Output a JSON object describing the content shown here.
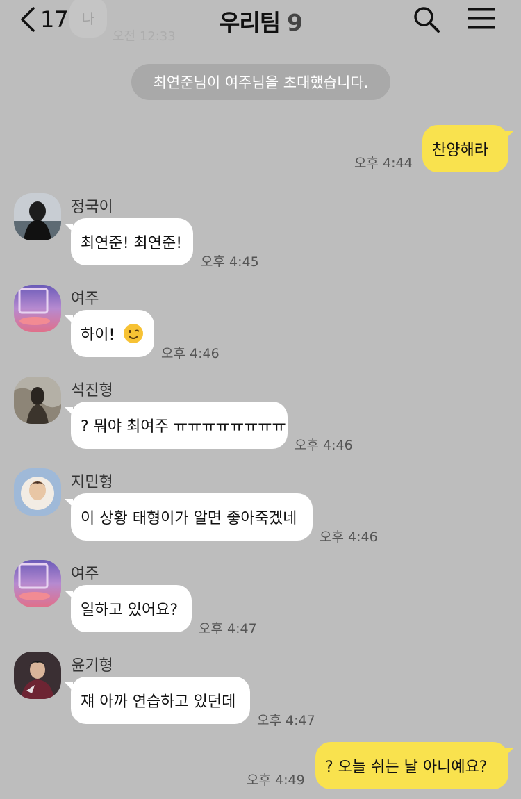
{
  "header": {
    "back_count": "17",
    "title": "우리팀",
    "member_count": "9"
  },
  "ghost": {
    "avatar_text": "나",
    "time": "오전 12:33"
  },
  "notice": "최연준님이 여주님을 초대했습니다.",
  "messages": [
    {
      "direction": "out",
      "text": "찬양해라",
      "time": "오후 4:44"
    },
    {
      "direction": "in",
      "sender": "정국이",
      "avatar": "jungkook-avatar",
      "text": "최연준! 최연준!",
      "time": "오후 4:45"
    },
    {
      "direction": "in",
      "sender": "여주",
      "avatar": "yeoju-avatar",
      "text": "하이!",
      "emoji": "wink-emoji",
      "time": "오후 4:46"
    },
    {
      "direction": "in",
      "sender": "석진형",
      "avatar": "seokjin-avatar",
      "text": "? 뭐야 최여주 ㅠㅠㅠㅠㅠㅠㅠㅠ",
      "time": "오후 4:46"
    },
    {
      "direction": "in",
      "sender": "지민형",
      "avatar": "jimin-avatar",
      "text": "이 상황 태형이가 알면 좋아죽겠네",
      "time": "오후 4:46"
    },
    {
      "direction": "in",
      "sender": "여주",
      "avatar": "yeoju-avatar",
      "text": "일하고 있어요?",
      "time": "오후 4:47"
    },
    {
      "direction": "in",
      "sender": "윤기형",
      "avatar": "yoongi-avatar",
      "text": "쟤 아까 연습하고 있던데",
      "time": "오후 4:47"
    },
    {
      "direction": "out",
      "text": "? 오늘 쉬는 날 아니예요?",
      "time": "오후 4:49"
    }
  ],
  "colors": {
    "background": "#bdbdbd",
    "my_bubble": "#f9e24e",
    "their_bubble": "#ffffff",
    "notice_bg": "#a9a9a9"
  },
  "icons": [
    "back-chevron-icon",
    "search-icon",
    "menu-icon",
    "wink-emoji"
  ]
}
